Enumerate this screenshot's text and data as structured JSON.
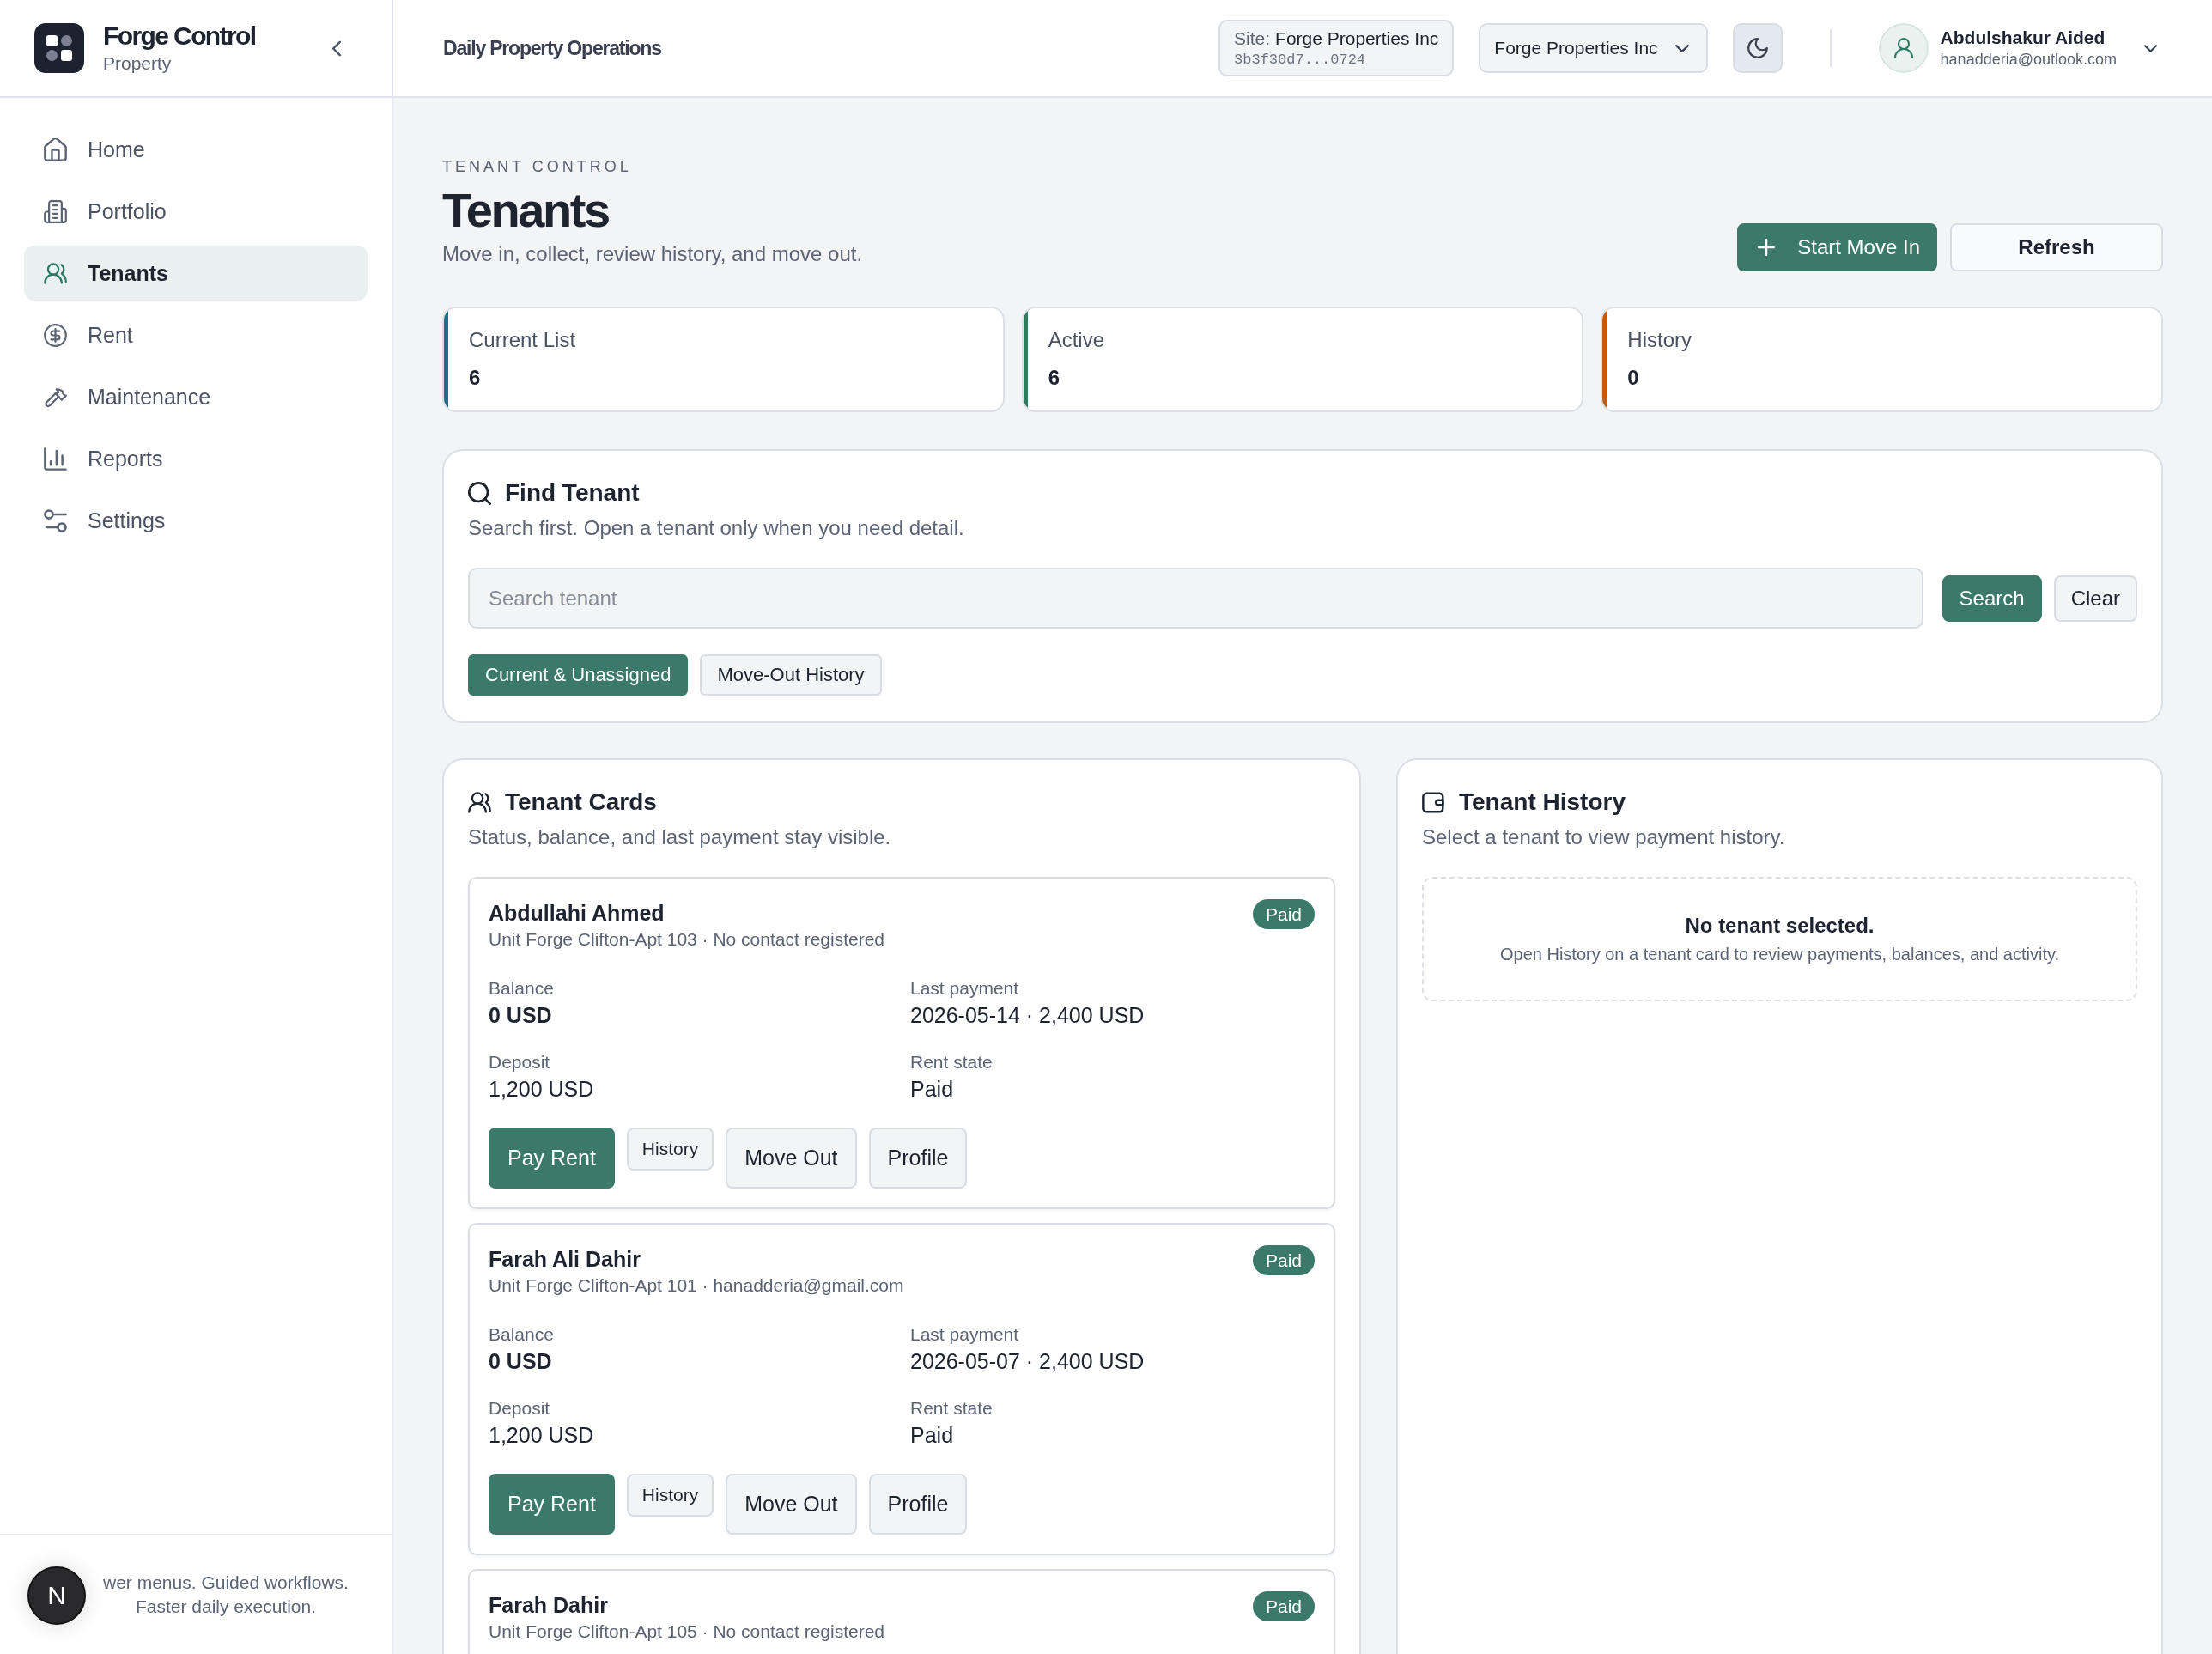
{
  "sidebar": {
    "brand": {
      "title": "Forge Control",
      "subtitle": "Property"
    },
    "items": [
      {
        "label": "Home",
        "selected": false
      },
      {
        "label": "Portfolio",
        "selected": false
      },
      {
        "label": "Tenants",
        "selected": true
      },
      {
        "label": "Rent",
        "selected": false
      },
      {
        "label": "Maintenance",
        "selected": false
      },
      {
        "label": "Reports",
        "selected": false
      },
      {
        "label": "Settings",
        "selected": false
      }
    ],
    "footer": {
      "text": "wer menus. Guided workflows.\nFaster daily execution."
    }
  },
  "dev_badge": {
    "label": "N"
  },
  "topbar": {
    "title": "Daily Property Operations",
    "site": {
      "label": "Site:",
      "value": "Forge Properties Inc",
      "code": "3b3f30d7...0724"
    },
    "org_select": {
      "value": "Forge Properties Inc"
    },
    "user": {
      "name": "Abdulshakur Aided",
      "email": "hanadderia@outlook.com"
    }
  },
  "header": {
    "eyebrow": "TENANT CONTROL",
    "title": "Tenants",
    "subtitle": "Move in, collect, review history, and move out.",
    "actions": [
      {
        "label": "Start Move In",
        "kind": "primary"
      },
      {
        "label": "Refresh",
        "kind": "secondary"
      }
    ]
  },
  "stats": [
    {
      "label": "Current List",
      "value": "6",
      "color": "#1f6f8b"
    },
    {
      "label": "Active",
      "value": "6",
      "color": "#2e7d5e"
    },
    {
      "label": "History",
      "value": "0",
      "color": "#c25a10"
    }
  ],
  "find": {
    "title": "Find Tenant",
    "subtitle": "Search first. Open a tenant only when you need detail.",
    "search": {
      "placeholder": "Search tenant"
    },
    "buttons": [
      {
        "label": "Search",
        "kind": "primary"
      },
      {
        "label": "Clear",
        "kind": "secondary"
      }
    ],
    "filters": [
      {
        "label": "Current & Unassigned",
        "selected": true
      },
      {
        "label": "Move-Out History",
        "selected": false
      }
    ]
  },
  "tenant_cards": {
    "title": "Tenant Cards",
    "subtitle": "Status, balance, and last payment stay visible.",
    "cards": [
      {
        "name": "Abdullahi Ahmed",
        "unit": "Unit Forge Clifton-Apt 103 · No contact registered",
        "status": "Paid",
        "fields": [
          {
            "label": "Balance",
            "value": "0 USD",
            "kind": "strong"
          },
          {
            "label": "Last payment",
            "value": "2026-05-14 · 2,400 USD",
            "kind": "plain"
          },
          {
            "label": "Deposit",
            "value": "1,200 USD",
            "kind": "plain"
          },
          {
            "label": "Rent state",
            "value": "Paid",
            "kind": "plain"
          }
        ],
        "actions": [
          {
            "label": "Pay Rent",
            "kind": "primary"
          },
          {
            "label": "History",
            "kind": "small"
          },
          {
            "label": "Move Out",
            "kind": "secondary"
          },
          {
            "label": "Profile",
            "kind": "secondary"
          }
        ]
      },
      {
        "name": "Farah Ali Dahir",
        "unit": "Unit Forge Clifton-Apt 101 · hanadderia@gmail.com",
        "status": "Paid",
        "fields": [
          {
            "label": "Balance",
            "value": "0 USD",
            "kind": "strong"
          },
          {
            "label": "Last payment",
            "value": "2026-05-07 · 2,400 USD",
            "kind": "plain"
          },
          {
            "label": "Deposit",
            "value": "1,200 USD",
            "kind": "plain"
          },
          {
            "label": "Rent state",
            "value": "Paid",
            "kind": "plain"
          }
        ],
        "actions": [
          {
            "label": "Pay Rent",
            "kind": "primary"
          },
          {
            "label": "History",
            "kind": "small"
          },
          {
            "label": "Move Out",
            "kind": "secondary"
          },
          {
            "label": "Profile",
            "kind": "secondary"
          }
        ]
      },
      {
        "name": "Farah Dahir",
        "unit": "Unit Forge Clifton-Apt 105 · No contact registered",
        "status": "Paid"
      }
    ]
  },
  "history": {
    "title": "Tenant History",
    "subtitle": "Select a tenant to view payment history.",
    "empty": {
      "title": "No tenant selected.",
      "text": "Open History on a tenant card to review payments, balances, and activity."
    }
  }
}
